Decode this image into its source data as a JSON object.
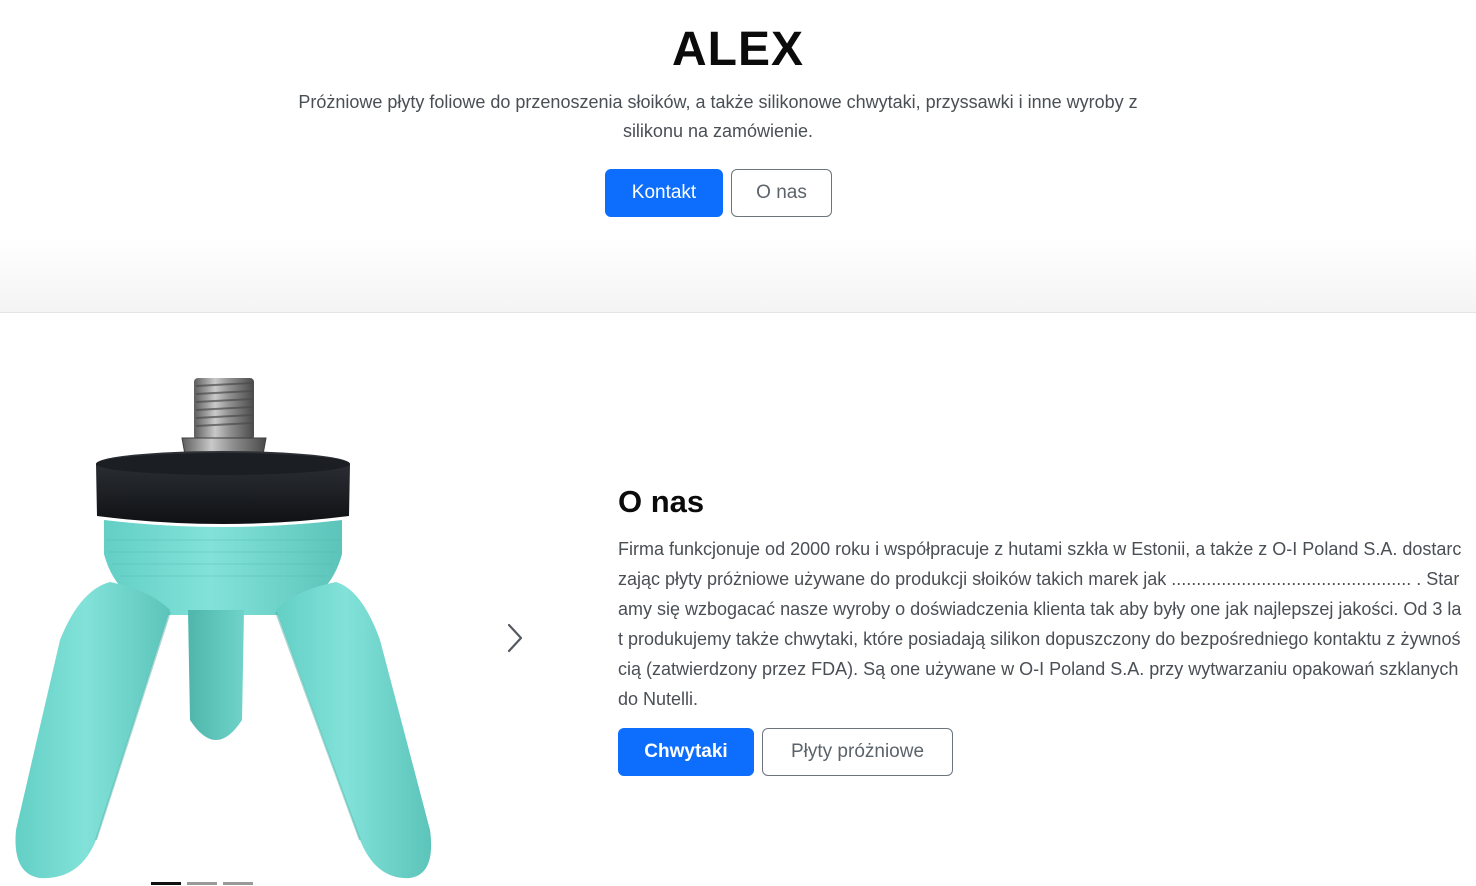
{
  "hero": {
    "title": "ALEX",
    "lead": "Próżniowe płyty foliowe do przenoszenia słoików, a także silikonowe chwytaki, przyssawki i inne wyroby z silikonu na zamówienie.",
    "primary_button": "Kontakt",
    "secondary_button": "O nas"
  },
  "carousel": {
    "image_icon": "silicone-gripper-photo",
    "next_icon": "chevron-right-icon",
    "indicators": 3,
    "active_indicator": 1
  },
  "about": {
    "title": "O nas",
    "text": "Firma funkcjonuje od 2000 roku i współpracuje z hutami szkła w Estonii, a także z O-I Poland S.A. dostarczając płyty próżniowe używane do produkcji słoików takich marek jak ................................................ . Staramy się wzbogacać nasze wyroby o doświadczenia klienta tak aby były one jak najlepszej jakości. Od 3 lat produkujemy także chwytaki, które posiadają silikon dopuszczony do bezpośredniego kontaktu z żywnością (zatwierdzony przez FDA). Są one używane w O-I Poland S.A. przy wytwarzaniu opakowań szklanych do Nutelli.",
    "primary_button": "Chwytaki",
    "secondary_button": "Płyty próżniowe"
  },
  "colors": {
    "accent": "#0d6efd",
    "gripper_body": "#74dcd2",
    "gripper_collar": "#15181c"
  }
}
